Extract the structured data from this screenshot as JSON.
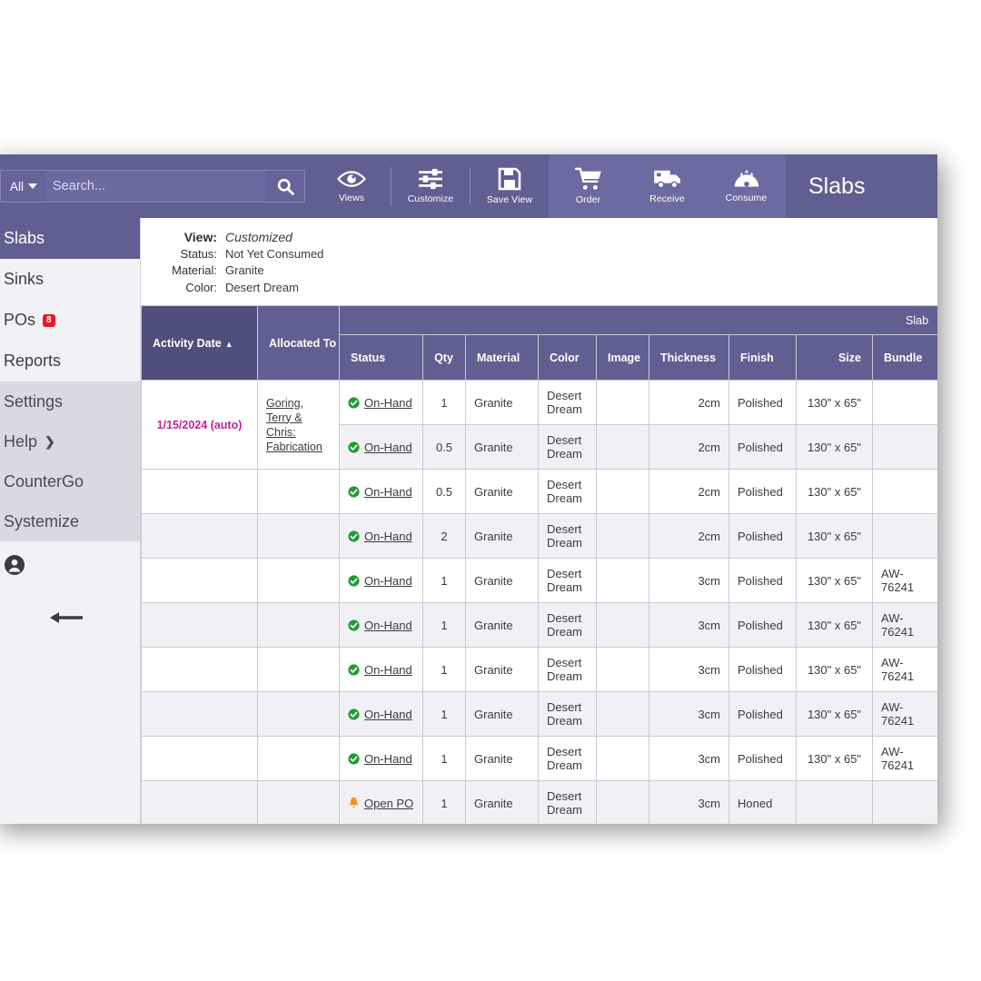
{
  "topbar": {
    "scope_label": "All",
    "search_value": "",
    "search_placeholder": "Search...",
    "search_icon": "search-icon",
    "tools": [
      {
        "label": "Views",
        "icon": "eye-icon"
      },
      {
        "label": "Customize",
        "icon": "sliders-icon"
      },
      {
        "label": "Save View",
        "icon": "floppy-disk-icon"
      },
      {
        "label": "Order",
        "icon": "shopping-cart-icon"
      },
      {
        "label": "Receive",
        "icon": "delivery-truck-icon"
      },
      {
        "label": "Consume",
        "icon": "saw-blade-icon"
      }
    ],
    "page_title": "Slabs"
  },
  "sidebar": {
    "primary": [
      {
        "label": "Slabs",
        "active": true,
        "badge": ""
      },
      {
        "label": "Sinks",
        "active": false,
        "badge": ""
      },
      {
        "label": "POs",
        "active": false,
        "badge": "8"
      },
      {
        "label": "Reports",
        "active": false,
        "badge": ""
      }
    ],
    "secondary": [
      {
        "label": "Settings",
        "chevron": false
      },
      {
        "label": "Help",
        "chevron": true
      },
      {
        "label": "CounterGo",
        "chevron": false
      },
      {
        "label": "Systemize",
        "chevron": false
      }
    ],
    "account_icon": "user-account-icon",
    "collapse_icon": "arrow-left-icon"
  },
  "view_summary": [
    {
      "label": "View:",
      "value": "Customized"
    },
    {
      "label": "Status:",
      "value": "Not Yet Consumed"
    },
    {
      "label": "Material:",
      "value": "Granite"
    },
    {
      "label": "Color:",
      "value": "Desert Dream"
    }
  ],
  "table": {
    "group_header": "Slab",
    "sort_indicator": "▲",
    "columns": {
      "activity_date": "Activity Date",
      "allocated_to": "Allocated To",
      "status": "Status",
      "qty": "Qty",
      "material": "Material",
      "color": "Color",
      "image": "Image",
      "thickness": "Thickness",
      "finish": "Finish",
      "size": "Size",
      "bundle": "Bundle"
    },
    "merged_date": "1/15/2024 (auto)",
    "merged_allocated": "Goring, Terry & Chris: Fabrication",
    "rows": [
      {
        "status": "On-Hand",
        "status_icon": "check-circle-icon",
        "qty": "1",
        "material": "Granite",
        "color": "Desert Dream",
        "image": "",
        "thickness": "2cm",
        "finish": "Polished",
        "size": "130\" x 65\"",
        "bundle": ""
      },
      {
        "status": "On-Hand",
        "status_icon": "check-circle-icon",
        "qty": "0.5",
        "material": "Granite",
        "color": "Desert Dream",
        "image": "",
        "thickness": "2cm",
        "finish": "Polished",
        "size": "130\" x 65\"",
        "bundle": ""
      },
      {
        "status": "On-Hand",
        "status_icon": "check-circle-icon",
        "qty": "0.5",
        "material": "Granite",
        "color": "Desert Dream",
        "image": "",
        "thickness": "2cm",
        "finish": "Polished",
        "size": "130\" x 65\"",
        "bundle": ""
      },
      {
        "status": "On-Hand",
        "status_icon": "check-circle-icon",
        "qty": "2",
        "material": "Granite",
        "color": "Desert Dream",
        "image": "",
        "thickness": "2cm",
        "finish": "Polished",
        "size": "130\" x 65\"",
        "bundle": ""
      },
      {
        "status": "On-Hand",
        "status_icon": "check-circle-icon",
        "qty": "1",
        "material": "Granite",
        "color": "Desert Dream",
        "image": "",
        "thickness": "3cm",
        "finish": "Polished",
        "size": "130\" x 65\"",
        "bundle": "AW-76241"
      },
      {
        "status": "On-Hand",
        "status_icon": "check-circle-icon",
        "qty": "1",
        "material": "Granite",
        "color": "Desert Dream",
        "image": "",
        "thickness": "3cm",
        "finish": "Polished",
        "size": "130\" x 65\"",
        "bundle": "AW-76241"
      },
      {
        "status": "On-Hand",
        "status_icon": "check-circle-icon",
        "qty": "1",
        "material": "Granite",
        "color": "Desert Dream",
        "image": "",
        "thickness": "3cm",
        "finish": "Polished",
        "size": "130\" x 65\"",
        "bundle": "AW-76241"
      },
      {
        "status": "On-Hand",
        "status_icon": "check-circle-icon",
        "qty": "1",
        "material": "Granite",
        "color": "Desert Dream",
        "image": "",
        "thickness": "3cm",
        "finish": "Polished",
        "size": "130\" x 65\"",
        "bundle": "AW-76241"
      },
      {
        "status": "On-Hand",
        "status_icon": "check-circle-icon",
        "qty": "1",
        "material": "Granite",
        "color": "Desert Dream",
        "image": "",
        "thickness": "3cm",
        "finish": "Polished",
        "size": "130\" x 65\"",
        "bundle": "AW-76241"
      },
      {
        "status": "Open PO",
        "status_icon": "bell-alert-icon",
        "qty": "1",
        "material": "Granite",
        "color": "Desert Dream",
        "image": "",
        "thickness": "3cm",
        "finish": "Honed",
        "size": "",
        "bundle": ""
      }
    ]
  },
  "colors": {
    "brand_purple": "#5f5f92",
    "brand_purple_dark": "#4f4f7d",
    "badge_red": "#e8182b",
    "date_magenta": "#c0249a",
    "status_green": "#1f9d35",
    "status_orange": "#f0941e"
  }
}
